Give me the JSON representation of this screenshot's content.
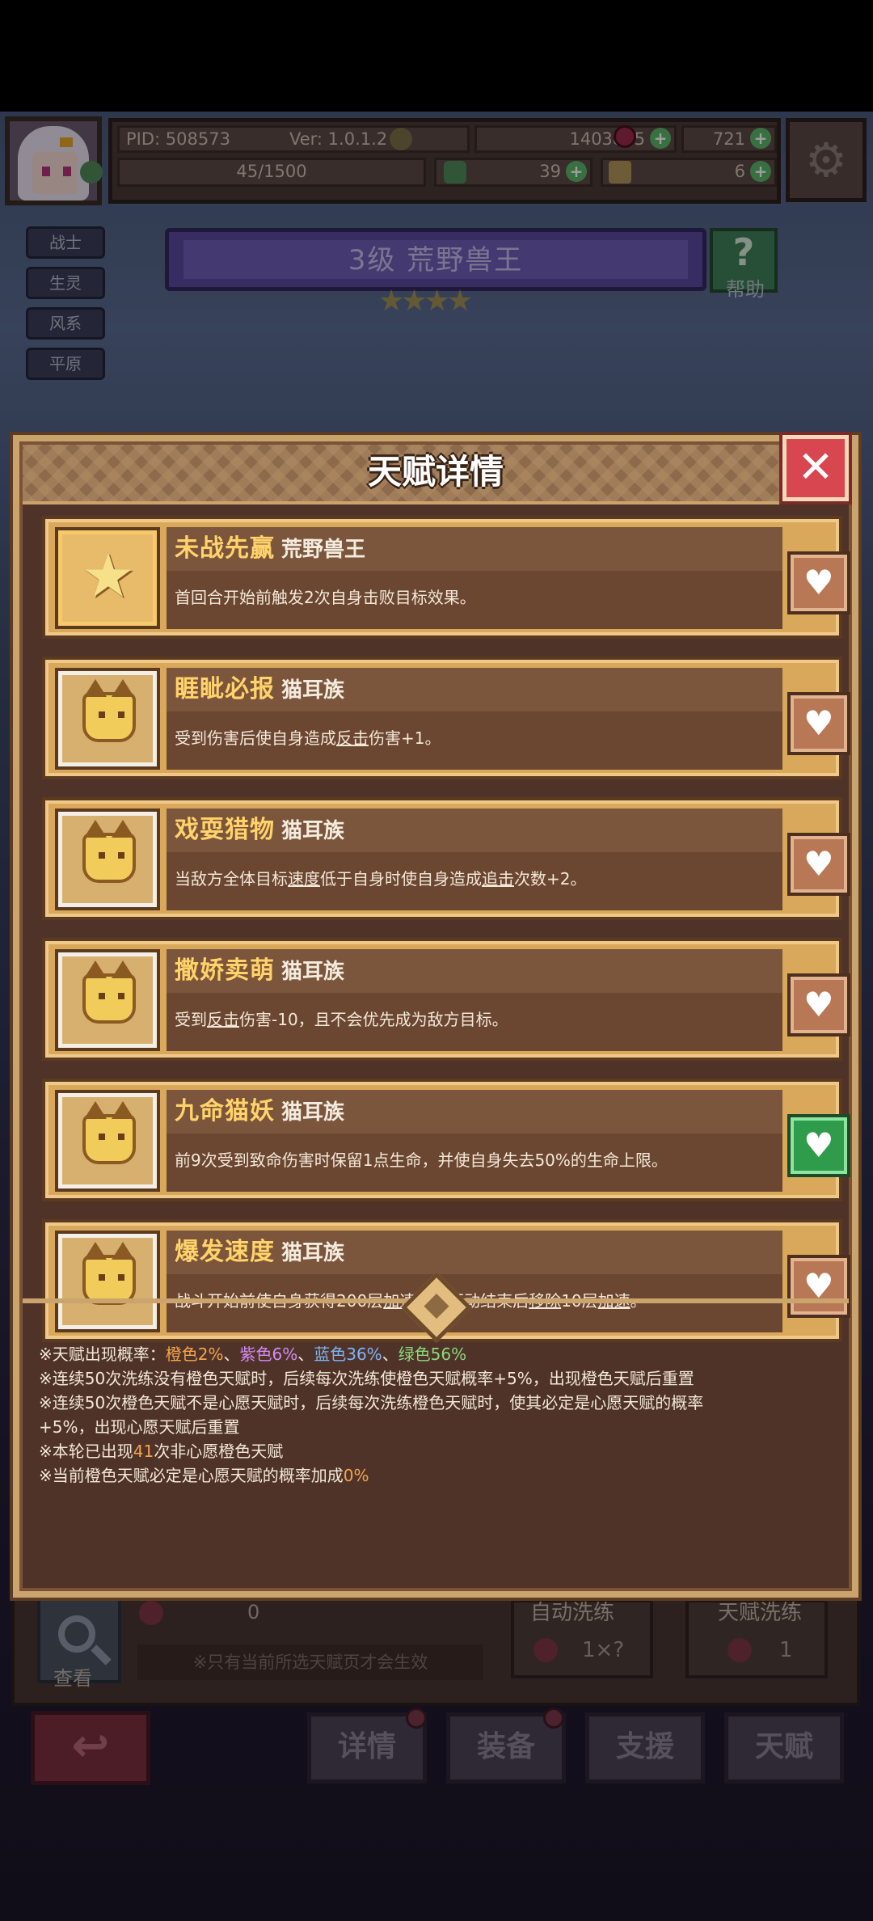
{
  "header": {
    "pid": "PID: 508573",
    "version": "Ver: 1.0.1.2",
    "gold": "1403855",
    "gems": "721",
    "exp": "45/1500",
    "clover": "39",
    "tickets": "6"
  },
  "tags": [
    "战士",
    "生灵",
    "风系",
    "平原"
  ],
  "banner": {
    "title": "3级 荒野兽王",
    "stars": "★★★★",
    "help_label": "帮助",
    "help_glyph": "?"
  },
  "modal": {
    "title": "天赋详情",
    "close_glyph": "✕",
    "talents": [
      {
        "name": "未战先赢",
        "tag": "荒野兽王",
        "icon": "star-icon",
        "frame": "legend",
        "active": false,
        "desc": [
          "首回合开始前触发2次自身击败目标效果。"
        ]
      },
      {
        "name": "睚眦必报",
        "tag": "猫耳族",
        "icon": "cat-icon",
        "frame": "normal",
        "active": false,
        "desc": [
          "受到伤害后使自身造成",
          "反击",
          "伤害+1。"
        ]
      },
      {
        "name": "戏耍猎物",
        "tag": "猫耳族",
        "icon": "cat-icon",
        "frame": "normal",
        "active": false,
        "desc": [
          "当敌方全体目标",
          "速度",
          "低于自身时使自身造成",
          "追击",
          "次数+2。"
        ]
      },
      {
        "name": "撒娇卖萌",
        "tag": "猫耳族",
        "icon": "cat-icon",
        "frame": "normal",
        "active": false,
        "desc": [
          "受到",
          "反击",
          "伤害-10，且不会优先成为敌方目标。"
        ]
      },
      {
        "name": "九命猫妖",
        "tag": "猫耳族",
        "icon": "cat-icon",
        "frame": "normal",
        "active": true,
        "desc": [
          "前9次受到致命伤害时保留1点生命，并使自身失去50%的生命上限。"
        ]
      },
      {
        "name": "爆发速度",
        "tag": "猫耳族",
        "icon": "cat-icon",
        "frame": "normal",
        "active": false,
        "desc": [
          "战斗开始前使自身获得200层",
          "加速",
          "，但行动结束后",
          "移除",
          "10层",
          "加速",
          "。"
        ]
      }
    ],
    "heart_glyph": "♥",
    "notes": {
      "prob_prefix": "※天赋出现概率：",
      "orange": "橙色2%",
      "sep": "、",
      "purple": "紫色6%",
      "blue": "蓝色36%",
      "green": "绿色56%",
      "line2": "※连续50次洗练没有橙色天赋时，后续每次洗练使橙色天赋概率+5%，出现橙色天赋后重置",
      "line3a": "※连续50次橙色天赋不是心愿天赋时，后续每次洗练橙色天赋时，使其必定是心愿天赋的概率",
      "line3b": "+5%，出现心愿天赋后重置",
      "line4_prefix": "※本轮已出现",
      "line4_count": "41",
      "line4_suffix": "次非心愿橙色天赋",
      "line5_prefix": "※当前橙色天赋必定是心愿天赋的概率加成",
      "line5_value": "0%"
    }
  },
  "lower": {
    "count": "0",
    "look_label": "查看",
    "note": "※只有当前所选天赋页才会生效",
    "auto_label": "自动洗练",
    "auto_value": "1×?",
    "wish_label": "天赋洗练",
    "wish_value": "1"
  },
  "bottom_nav": [
    "详情",
    "装备",
    "支援",
    "天赋"
  ],
  "back_glyph": "↩",
  "colors": {
    "gold_text": "#ffd26a",
    "orange": "#f2a54a",
    "purple": "#d48af3",
    "blue": "#7eb5f7",
    "green": "#8bd97a",
    "active_heart": "#2e9c4a"
  }
}
